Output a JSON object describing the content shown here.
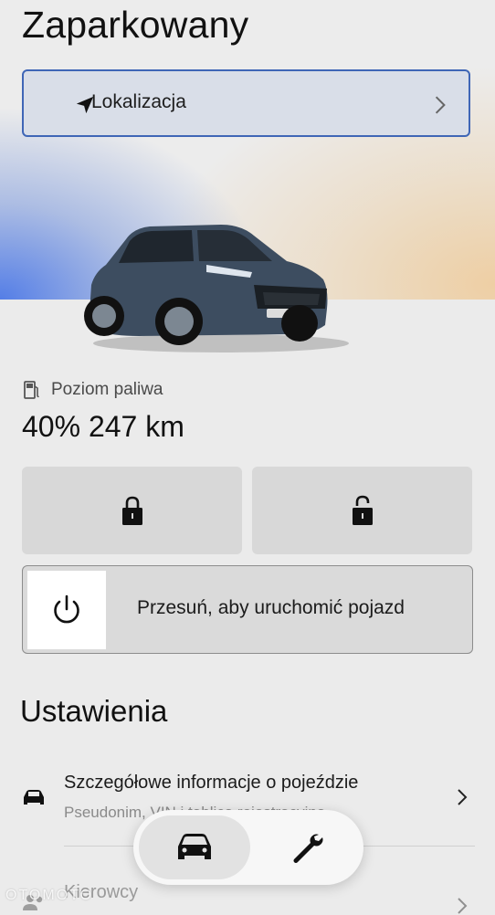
{
  "header": {
    "status": "Zaparkowany"
  },
  "location_button": {
    "label": "Lokalizacja",
    "icon": "navigation-arrow-icon"
  },
  "vehicle": {
    "image": "car-icon"
  },
  "fuel": {
    "label": "Poziom paliwa",
    "value": "40% 247 km",
    "icon": "fuel-pump-icon"
  },
  "lock_buttons": [
    {
      "icon": "lock-icon"
    },
    {
      "icon": "unlock-icon"
    }
  ],
  "remote_start": {
    "label": "Przesuń, aby uruchomić pojazd",
    "icon": "power-icon"
  },
  "settings": {
    "title": "Ustawienia",
    "items": [
      {
        "title": "Szczegółowe informacje o pojeździe",
        "subtitle": "Pseudonim, VIN i tablica rejestracyjna",
        "icon": "car-icon"
      },
      {
        "title": "Kierowcy",
        "icon": "people-icon"
      }
    ]
  },
  "bottom_nav": {
    "tabs": [
      {
        "icon": "car-icon"
      },
      {
        "icon": "wrench-icon"
      }
    ]
  },
  "watermark": "OTOMOTO",
  "colors": {
    "accent_border": "#3f66b6",
    "location_bg": "#d9dee8",
    "button_bg": "#d8d8d8",
    "page_bg": "#ebebeb"
  }
}
